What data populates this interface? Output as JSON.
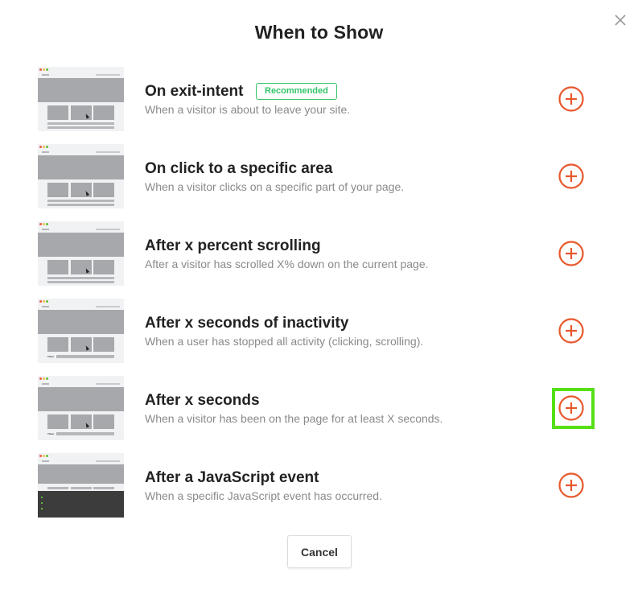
{
  "modal": {
    "title": "When to Show",
    "cancel_label": "Cancel",
    "close_icon": "close-icon"
  },
  "colors": {
    "accent": "#e8582c",
    "recommended_green": "#34c46a",
    "highlight_green": "#55e015"
  },
  "options": [
    {
      "title": "On exit-intent",
      "description": "When a visitor is about to leave your site.",
      "badge": "Recommended",
      "icon": "plus-circle-icon"
    },
    {
      "title": "On click to a specific area",
      "description": "When a visitor clicks on a specific part of your page.",
      "icon": "plus-circle-icon"
    },
    {
      "title": "After x percent scrolling",
      "description": "After a visitor has scrolled X% down on the current page.",
      "icon": "plus-circle-icon"
    },
    {
      "title": "After x seconds of inactivity",
      "description": "When a user has stopped all activity (clicking, scrolling).",
      "thumb_label": "Timer",
      "icon": "plus-circle-icon"
    },
    {
      "title": "After x seconds",
      "description": "When a visitor has been on the page for at least X seconds.",
      "thumb_label": "Timer",
      "icon": "plus-circle-icon",
      "highlighted": true
    },
    {
      "title": "After a JavaScript event",
      "description": "When a specific JavaScript event has occurred.",
      "icon": "plus-circle-icon"
    }
  ]
}
